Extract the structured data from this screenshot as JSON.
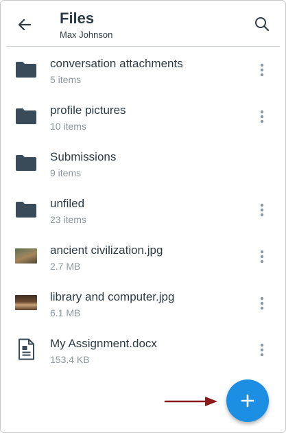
{
  "header": {
    "title": "Files",
    "subtitle": "Max Johnson",
    "back_icon": "arrow-left-icon",
    "search_icon": "search-icon"
  },
  "files": [
    {
      "name": "conversation attachments",
      "meta": "5 items",
      "type": "folder",
      "has_menu": true
    },
    {
      "name": "profile pictures",
      "meta": "10 items",
      "type": "folder",
      "has_menu": true
    },
    {
      "name": "Submissions",
      "meta": "9 items",
      "type": "folder",
      "has_menu": false
    },
    {
      "name": "unfiled",
      "meta": "23 items",
      "type": "folder",
      "has_menu": true
    },
    {
      "name": "ancient civilization.jpg",
      "meta": "2.7 MB",
      "type": "image",
      "has_menu": true
    },
    {
      "name": "library and computer.jpg",
      "meta": "6.1 MB",
      "type": "image",
      "has_menu": true
    },
    {
      "name": "My Assignment.docx",
      "meta": "153.4 KB",
      "type": "document",
      "has_menu": true
    }
  ],
  "fab": {
    "icon": "plus-icon",
    "color": "#1c8fe3"
  },
  "annotation": {
    "arrow_color": "#8b1a1a"
  },
  "colors": {
    "text_primary": "#2d3b45",
    "text_secondary": "#8b969e",
    "folder": "#394b58",
    "divider": "#c7cdd1"
  }
}
